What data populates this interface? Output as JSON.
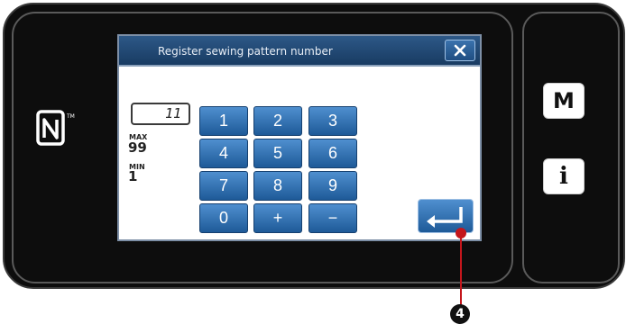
{
  "dialog": {
    "title": "Register sewing pattern number",
    "close_icon": "close-x-icon"
  },
  "input": {
    "value": "11",
    "max_caption": "MAX",
    "max_value": "99",
    "min_caption": "MIN",
    "min_value": "1"
  },
  "keypad": {
    "keys": [
      "1",
      "2",
      "3",
      "4",
      "5",
      "6",
      "7",
      "8",
      "9",
      "0",
      "+",
      "−"
    ]
  },
  "enter": {
    "icon": "enter-return-icon"
  },
  "side": {
    "menu_label": "M",
    "info_label": "i"
  },
  "nfc": {
    "icon": "nfc-icon"
  },
  "callout": {
    "number": "4"
  },
  "colors": {
    "key_blue": "#2a6bb0",
    "titlebar_blue": "#1f4b7a",
    "callout_red": "#c4161c"
  }
}
